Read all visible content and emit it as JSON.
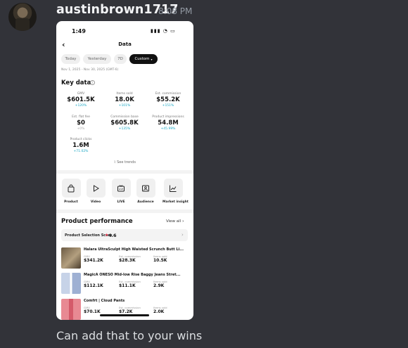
{
  "message": {
    "username": "austinbrown1717",
    "timestamp": "8:08 PM",
    "text": "Can add that to your wins"
  },
  "phone": {
    "status_time": "1:49",
    "status_right": "▮▮▮ ◔ ▭",
    "page_title": "Data",
    "back_icon": "chevron-left",
    "filters": [
      "Today",
      "Yesterday",
      "7D",
      "Custom"
    ],
    "active_filter": "Custom",
    "date_range": "Nov 1, 2025 - Nov 30, 2025 (GMT-6)",
    "key_data": {
      "title": "Key data",
      "metrics": [
        {
          "label": "GMV",
          "value": "$601.5K",
          "change": "+120%"
        },
        {
          "label": "Items sold",
          "value": "18.0K",
          "change": "+101%"
        },
        {
          "label": "Est. commission",
          "value": "$55.2K",
          "change": "+151%"
        },
        {
          "label": "Est. flat fee",
          "value": "$0",
          "change": "+0%"
        },
        {
          "label": "Commission base",
          "value": "$605.8K",
          "change": "+135%"
        },
        {
          "label": "Product impressions",
          "value": "54.8M",
          "change": "+45.99%"
        },
        {
          "label": "Product clicks",
          "value": "1.6M",
          "change": "+71.02%"
        }
      ],
      "see_trends": "See trends"
    },
    "quick_icons": [
      {
        "label": "Product",
        "icon": "bag-icon"
      },
      {
        "label": "Video",
        "icon": "play-icon"
      },
      {
        "label": "LIVE",
        "icon": "live-icon"
      },
      {
        "label": "Audience",
        "icon": "audience-icon"
      },
      {
        "label": "Market insight",
        "icon": "chart-icon"
      }
    ],
    "product_performance": {
      "title": "Product performance",
      "view_all": "View all",
      "selection_score_label": "Product Selection Score",
      "selection_score_value": "4.6",
      "products": [
        {
          "name": "Halara UltraSculpt High Waisted Scrunch Butt Li...",
          "gmv": "$341.2K",
          "commission": "$28.3K",
          "items_sold": "10.5K",
          "thumb_color": "#8a7a62"
        },
        {
          "name": "MagicA ONESO Mid-low Rise Baggy Jeans Stret...",
          "gmv": "$112.1K",
          "commission": "$11.1K",
          "items_sold": "2.9K",
          "thumb_color": "#a9b9d6"
        },
        {
          "name": "Comfrt | Cloud Pants",
          "gmv": "$70.1K",
          "commission": "$7.2K",
          "items_sold": "2.0K",
          "thumb_color": "#e07a86"
        }
      ],
      "metric_labels": {
        "gmv": "GMV",
        "commission": "Est. commission",
        "items_sold": "Items sold"
      }
    }
  }
}
